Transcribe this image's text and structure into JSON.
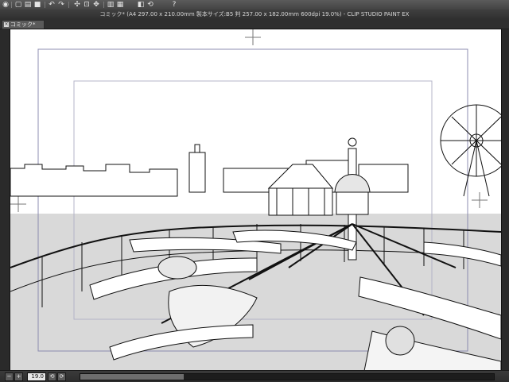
{
  "app": {
    "window_title": "コミック* (A4 297.00 x 210.00mm 製本サイズ:B5 判 257.00 x 182.00mm 600dpi 19.0%)  - CLIP STUDIO PAINT EX"
  },
  "tabs": [
    {
      "label": "コミック*"
    }
  ],
  "status": {
    "zoom_value": "19.0"
  },
  "icons": {
    "toolbar": [
      "app-logo-icon",
      "new-icon",
      "open-icon",
      "save-icon",
      "undo-icon",
      "redo-icon",
      "select-all-icon",
      "deselect-icon",
      "transform-icon",
      "layer-icon",
      "grid-icon",
      "view-icon",
      "rotate-icon",
      "help-icon"
    ],
    "status": [
      "zoom-out-icon",
      "zoom-in-icon",
      "rotate-left-icon",
      "rotate-right-icon"
    ]
  }
}
